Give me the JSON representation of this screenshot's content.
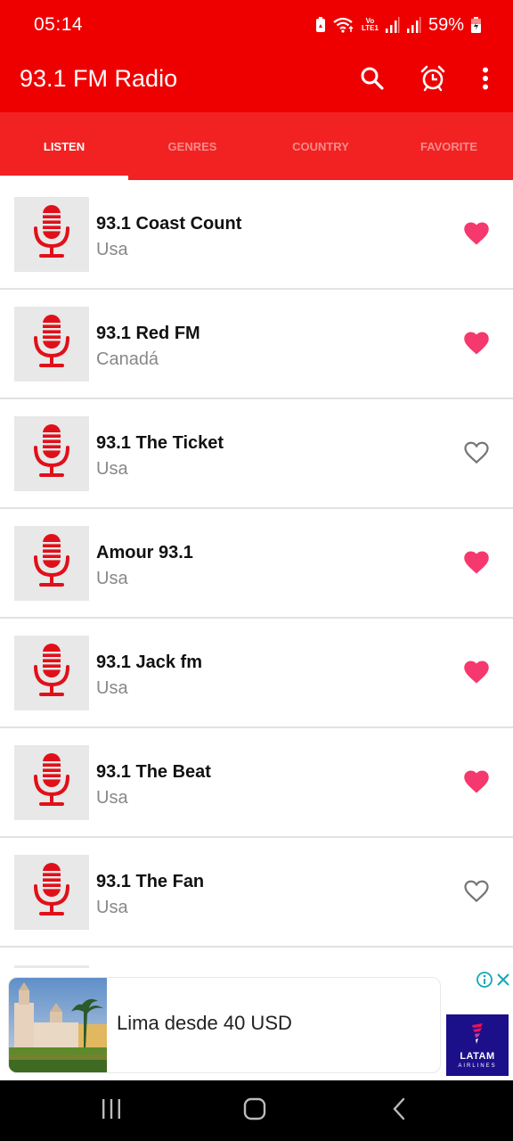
{
  "status_bar": {
    "time": "05:14",
    "battery_percent": "59%",
    "network_label_top": "Vo",
    "network_label_bottom": "LTE1",
    "icons": [
      "battery-saver-icon",
      "wifi-icon",
      "volte-icon",
      "signal-icon",
      "signal-icon",
      "battery-charging-icon"
    ]
  },
  "app_bar": {
    "title": "93.1 FM Radio",
    "actions": [
      {
        "name": "search",
        "icon": "search-icon"
      },
      {
        "name": "alarm",
        "icon": "alarm-clock-icon"
      },
      {
        "name": "more",
        "icon": "more-vert-icon"
      }
    ]
  },
  "tabs": [
    {
      "label": "LISTEN",
      "active": true
    },
    {
      "label": "GENRES",
      "active": false
    },
    {
      "label": "COUNTRY",
      "active": false
    },
    {
      "label": "FAVORITE",
      "active": false
    }
  ],
  "stations": [
    {
      "name": "93.1 Coast Count",
      "country": "Usa",
      "favorite": true
    },
    {
      "name": "93.1 Red FM",
      "country": "Canadá",
      "favorite": true
    },
    {
      "name": "93.1 The Ticket",
      "country": "Usa",
      "favorite": false
    },
    {
      "name": "Amour 93.1",
      "country": "Usa",
      "favorite": true
    },
    {
      "name": "93.1 Jack fm",
      "country": "Usa",
      "favorite": true
    },
    {
      "name": "93.1 The Beat",
      "country": "Usa",
      "favorite": true
    },
    {
      "name": "93.1 The Fan",
      "country": "Usa",
      "favorite": false
    }
  ],
  "ad": {
    "headline": "Lima desde 40 USD",
    "advertiser_brand": "LATAM",
    "advertiser_sub": "AIRLINES"
  },
  "colors": {
    "primary": "#ee0000",
    "tab_bar": "#f22222",
    "favorite_active": "#f5386d",
    "favorite_inactive": "#777777",
    "mic_icon": "#e0101a",
    "ad_accent": "#10a8b8"
  }
}
